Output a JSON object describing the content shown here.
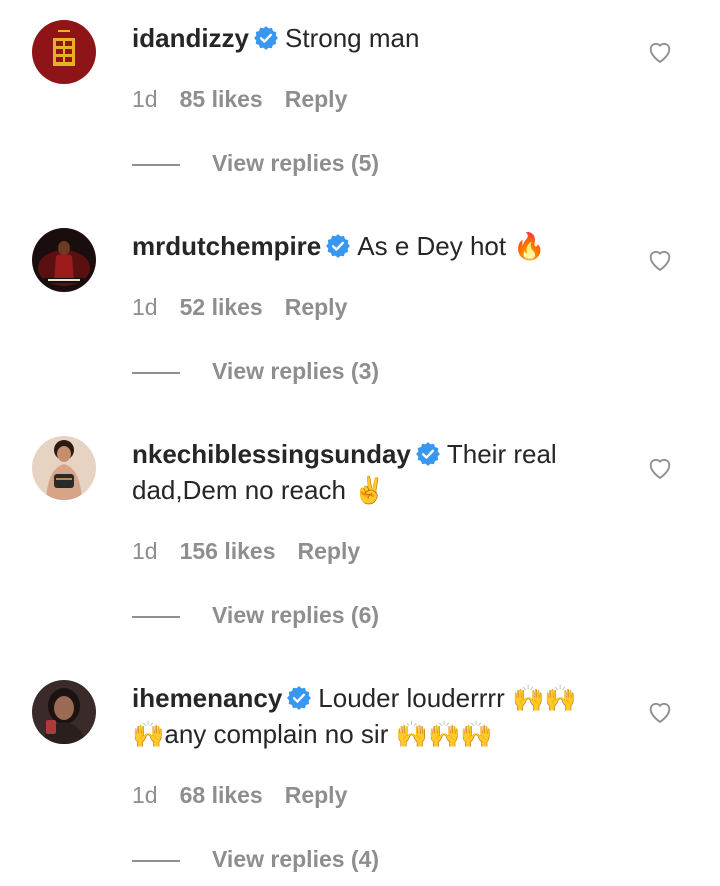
{
  "comments": [
    {
      "username": "idandizzy",
      "text": "Strong man",
      "time": "1d",
      "likes": "85 likes",
      "reply": "Reply",
      "view_replies": "View replies (5)",
      "avatar_icon": "album-cover-avatar"
    },
    {
      "username": "mrdutchempire",
      "text": "As e Dey hot",
      "emoji": "🔥",
      "time": "1d",
      "likes": "52 likes",
      "reply": "Reply",
      "view_replies": "View replies (3)",
      "avatar_icon": "mamacita-poster-avatar"
    },
    {
      "username": "nkechiblessingsunday",
      "text_line1": "Their real",
      "text_line2": "dad,Dem no reach",
      "emoji": "✌️",
      "time": "1d",
      "likes": "156 likes",
      "reply": "Reply",
      "view_replies": "View replies (6)",
      "avatar_icon": "woman-photo-avatar"
    },
    {
      "username": "ihemenancy",
      "text_line1": "Louder louderrrr",
      "emoji_a": "🙌🙌",
      "emoji_b": "🙌",
      "text_line2": "any complain no sir",
      "emoji_c": "🙌🙌🙌",
      "time": "1d",
      "likes": "68 likes",
      "reply": "Reply",
      "view_replies": "View replies (4)",
      "avatar_icon": "woman-selfie-avatar"
    }
  ],
  "icons": {
    "verified": "verified-badge-icon",
    "heart": "heart-outline-icon"
  },
  "colors": {
    "text": "#262626",
    "meta": "#8e8e8e",
    "verified": "#3897f0"
  }
}
